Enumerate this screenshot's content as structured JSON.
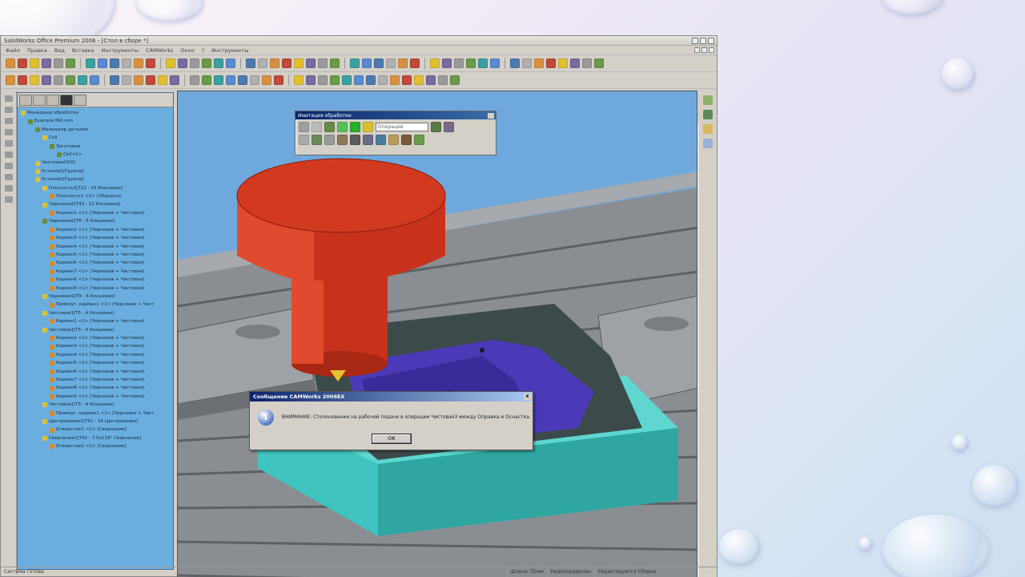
{
  "window": {
    "title": "SolidWorks Office Premium 2006 - [Стол в сборе *]"
  },
  "menu": [
    "Файл",
    "Правка",
    "Вид",
    "Вставка",
    "Инструменты",
    "CAMWorks",
    "Окно",
    "?",
    "Инструменты"
  ],
  "tree": {
    "items": [
      {
        "label": "Менеджер обработки",
        "indent": 0,
        "icon": "y"
      },
      {
        "label": "Example Mill mm",
        "indent": 1,
        "icon": "g"
      },
      {
        "label": "Менеджер деталей",
        "indent": 2,
        "icon": "g"
      },
      {
        "label": "Cell",
        "indent": 3,
        "icon": "y"
      },
      {
        "label": "Заготовки",
        "indent": 4,
        "icon": "g"
      },
      {
        "label": "Cell<1>",
        "indent": 5,
        "icon": "g"
      },
      {
        "label": "Чистовая(300)",
        "indent": 2,
        "icon": "y"
      },
      {
        "label": "Установ1[Группа]",
        "indent": 2,
        "icon": "y"
      },
      {
        "label": "Установ2[Группа]",
        "indent": 2,
        "icon": "y"
      },
      {
        "label": "Плоскость1[T21 - 25 Концевая]",
        "indent": 3,
        "icon": "y"
      },
      {
        "label": "Плоскость1 <1> [Обдирка]",
        "indent": 4,
        "icon": "o"
      },
      {
        "label": "Черновая1[T42 - 12 Концевая]",
        "indent": 3,
        "icon": "y"
      },
      {
        "label": "Карман1 <1> [Черновая + Чистовая]",
        "indent": 4,
        "icon": "o"
      },
      {
        "label": "Черновая1[T8 - 6 Концевая]",
        "indent": 3,
        "icon": "g"
      },
      {
        "label": "Карман2 <1> [Черновая + Чистовая]",
        "indent": 4,
        "icon": "o"
      },
      {
        "label": "Карман3 <1> [Черновая + Чистовая]",
        "indent": 4,
        "icon": "o"
      },
      {
        "label": "Карман4 <1> [Черновая + Чистовая]",
        "indent": 4,
        "icon": "o"
      },
      {
        "label": "Карман5 <1> [Черновая + Чистовая]",
        "indent": 4,
        "icon": "o"
      },
      {
        "label": "Карман6 <1> [Черновая + Чистовая]",
        "indent": 4,
        "icon": "o"
      },
      {
        "label": "Карман7 <1> [Черновая + Чистовая]",
        "indent": 4,
        "icon": "o"
      },
      {
        "label": "Карман8 <1> [Черновая + Чистовая]",
        "indent": 4,
        "icon": "o"
      },
      {
        "label": "Карман9 <1> [Черновая + Чистовая]",
        "indent": 4,
        "icon": "o"
      },
      {
        "label": "Черновая1[T9 - 6 Концевая]",
        "indent": 3,
        "icon": "y"
      },
      {
        "label": "Прямоуг. карман1 <1> [Черновая + Чист",
        "indent": 4,
        "icon": "o"
      },
      {
        "label": "Чистовая1[T5 - 4 Концевая]",
        "indent": 3,
        "icon": "y"
      },
      {
        "label": "Карман1 <1> [Черновая + Чистовая]",
        "indent": 4,
        "icon": "o"
      },
      {
        "label": "Чистовая1[T5 - 4 Концевая]",
        "indent": 3,
        "icon": "y"
      },
      {
        "label": "Карман2 <1> [Черновая + Чистовая]",
        "indent": 4,
        "icon": "o"
      },
      {
        "label": "Карман3 <1> [Черновая + Чистовая]",
        "indent": 4,
        "icon": "o"
      },
      {
        "label": "Карман4 <1> [Черновая + Чистовая]",
        "indent": 4,
        "icon": "o"
      },
      {
        "label": "Карман5 <1> [Черновая + Чистовая]",
        "indent": 4,
        "icon": "o"
      },
      {
        "label": "Карман6 <1> [Черновая + Чистовая]",
        "indent": 4,
        "icon": "o"
      },
      {
        "label": "Карман7 <1> [Черновая + Чистовая]",
        "indent": 4,
        "icon": "o"
      },
      {
        "label": "Карман8 <1> [Черновая + Чистовая]",
        "indent": 4,
        "icon": "o"
      },
      {
        "label": "Карман9 <1> [Черновая + Чистовая]",
        "indent": 4,
        "icon": "o"
      },
      {
        "label": "Чистовая1[T5 - 4 Концевая]",
        "indent": 3,
        "icon": "y"
      },
      {
        "label": "Прямоуг. карман1 <1> [Черновая + Чист",
        "indent": 4,
        "icon": "o"
      },
      {
        "label": "Центрование1[T41 - 16 Центрование]",
        "indent": 3,
        "icon": "y"
      },
      {
        "label": "Отверстие1 <1> [Сверление]",
        "indent": 4,
        "icon": "o"
      },
      {
        "label": "Сверление1[T42 - 7.5x118° Сверление]",
        "indent": 3,
        "icon": "y"
      },
      {
        "label": "Отверстие2 <1> [Сверление]",
        "indent": 4,
        "icon": "o"
      }
    ]
  },
  "float_toolbar": {
    "title": "Имитация обработки",
    "operation_select": "Операции"
  },
  "dialog": {
    "title": "Сообщение CAMWorks 2006EX",
    "message": "ВНИМАНИЕ: Столкновение на рабочей подаче в операции Чистовая3 между Оправка и Оснастка.",
    "ok_label": "OK",
    "close_label": "x",
    "info_glyph": "i"
  },
  "status": {
    "main": "Система готова",
    "length": "Длина: 55мм",
    "defined": "Недоопределен",
    "editing": "Редактируется Сборка"
  },
  "colors": {
    "viewport_bg": "#6fa8dc",
    "tool": "#d23a20",
    "part": "#4a3ab8",
    "fixture": "#3fc4c0",
    "table": "#8a8e92",
    "tree_bg": "#6aaee0"
  }
}
